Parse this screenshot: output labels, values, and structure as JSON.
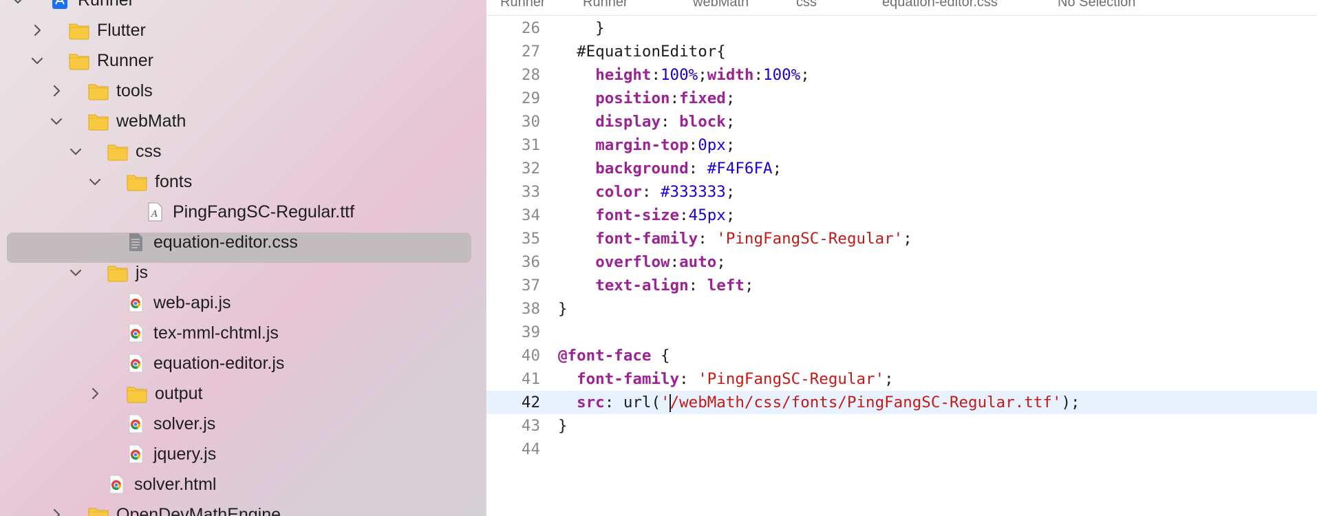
{
  "navigator": {
    "items": [
      {
        "label": "Runner",
        "icon": "xcode-project-icon",
        "chevron": "down"
      },
      {
        "label": "Flutter",
        "icon": "folder-icon",
        "chevron": "right"
      },
      {
        "label": "Runner",
        "icon": "folder-icon",
        "chevron": "down"
      },
      {
        "label": "tools",
        "icon": "folder-icon",
        "chevron": "right"
      },
      {
        "label": "webMath",
        "icon": "folder-icon",
        "chevron": "down"
      },
      {
        "label": "css",
        "icon": "folder-icon",
        "chevron": "down"
      },
      {
        "label": "fonts",
        "icon": "folder-icon",
        "chevron": "down"
      },
      {
        "label": "PingFangSC-Regular.ttf",
        "icon": "font-file-icon",
        "chevron": ""
      },
      {
        "label": "equation-editor.css",
        "icon": "css-file-icon",
        "chevron": "",
        "selected": true
      },
      {
        "label": "js",
        "icon": "folder-icon",
        "chevron": "down"
      },
      {
        "label": "web-api.js",
        "icon": "chrome-file-icon",
        "chevron": ""
      },
      {
        "label": "tex-mml-chtml.js",
        "icon": "chrome-file-icon",
        "chevron": ""
      },
      {
        "label": "equation-editor.js",
        "icon": "chrome-file-icon",
        "chevron": ""
      },
      {
        "label": "output",
        "icon": "folder-icon",
        "chevron": "right"
      },
      {
        "label": "solver.js",
        "icon": "chrome-file-icon",
        "chevron": ""
      },
      {
        "label": "jquery.js",
        "icon": "chrome-file-icon",
        "chevron": ""
      },
      {
        "label": "solver.html",
        "icon": "chrome-file-icon",
        "chevron": ""
      },
      {
        "label": "OpenDevMathEngine",
        "icon": "folder-icon",
        "chevron": "right"
      }
    ],
    "colors": {
      "folder": "#f9c941",
      "selection": "#c2bcbf",
      "project_icon": "#1e6ff0"
    }
  },
  "jumpbar": {
    "crumbs": [
      "Runner",
      "Runner",
      "webMath",
      "css",
      "equation-editor.css",
      "No Selection"
    ]
  },
  "editor": {
    "current_line": 42,
    "lines": [
      {
        "num": "26",
        "tokens": [
          {
            "t": "plain",
            "v": "    }"
          }
        ]
      },
      {
        "num": "27",
        "tokens": [
          {
            "t": "plain",
            "v": "  #EquationEditor{"
          }
        ]
      },
      {
        "num": "28",
        "tokens": [
          {
            "t": "plain",
            "v": "    "
          },
          {
            "t": "prop",
            "v": "height"
          },
          {
            "t": "plain",
            "v": ":"
          },
          {
            "t": "val",
            "v": "100%"
          },
          {
            "t": "plain",
            "v": ";"
          },
          {
            "t": "prop",
            "v": "width"
          },
          {
            "t": "plain",
            "v": ":"
          },
          {
            "t": "val",
            "v": "100%"
          },
          {
            "t": "plain",
            "v": ";"
          }
        ]
      },
      {
        "num": "29",
        "tokens": [
          {
            "t": "plain",
            "v": "    "
          },
          {
            "t": "prop",
            "v": "position"
          },
          {
            "t": "plain",
            "v": ":"
          },
          {
            "t": "kw",
            "v": "fixed"
          },
          {
            "t": "plain",
            "v": ";"
          }
        ]
      },
      {
        "num": "30",
        "tokens": [
          {
            "t": "plain",
            "v": "    "
          },
          {
            "t": "prop",
            "v": "display"
          },
          {
            "t": "plain",
            "v": ": "
          },
          {
            "t": "kw",
            "v": "block"
          },
          {
            "t": "plain",
            "v": ";"
          }
        ]
      },
      {
        "num": "31",
        "tokens": [
          {
            "t": "plain",
            "v": "    "
          },
          {
            "t": "prop",
            "v": "margin-top"
          },
          {
            "t": "plain",
            "v": ":"
          },
          {
            "t": "val",
            "v": "0px"
          },
          {
            "t": "plain",
            "v": ";"
          }
        ]
      },
      {
        "num": "32",
        "tokens": [
          {
            "t": "plain",
            "v": "    "
          },
          {
            "t": "prop",
            "v": "background"
          },
          {
            "t": "plain",
            "v": ": "
          },
          {
            "t": "val",
            "v": "#F4F6FA"
          },
          {
            "t": "plain",
            "v": ";"
          }
        ]
      },
      {
        "num": "33",
        "tokens": [
          {
            "t": "plain",
            "v": "    "
          },
          {
            "t": "prop",
            "v": "color"
          },
          {
            "t": "plain",
            "v": ": "
          },
          {
            "t": "val",
            "v": "#333333"
          },
          {
            "t": "plain",
            "v": ";"
          }
        ]
      },
      {
        "num": "34",
        "tokens": [
          {
            "t": "plain",
            "v": "    "
          },
          {
            "t": "prop",
            "v": "font-size"
          },
          {
            "t": "plain",
            "v": ":"
          },
          {
            "t": "val",
            "v": "45px"
          },
          {
            "t": "plain",
            "v": ";"
          }
        ]
      },
      {
        "num": "35",
        "tokens": [
          {
            "t": "plain",
            "v": "    "
          },
          {
            "t": "prop",
            "v": "font-family"
          },
          {
            "t": "plain",
            "v": ": "
          },
          {
            "t": "str",
            "v": "'PingFangSC-Regular'"
          },
          {
            "t": "plain",
            "v": ";"
          }
        ]
      },
      {
        "num": "36",
        "tokens": [
          {
            "t": "plain",
            "v": "    "
          },
          {
            "t": "prop",
            "v": "overflow"
          },
          {
            "t": "plain",
            "v": ":"
          },
          {
            "t": "kw",
            "v": "auto"
          },
          {
            "t": "plain",
            "v": ";"
          }
        ]
      },
      {
        "num": "37",
        "tokens": [
          {
            "t": "plain",
            "v": "    "
          },
          {
            "t": "prop",
            "v": "text-align"
          },
          {
            "t": "plain",
            "v": ": "
          },
          {
            "t": "kw",
            "v": "left"
          },
          {
            "t": "plain",
            "v": ";"
          }
        ]
      },
      {
        "num": "38",
        "tokens": [
          {
            "t": "plain",
            "v": "}"
          }
        ]
      },
      {
        "num": "39",
        "tokens": []
      },
      {
        "num": "40",
        "tokens": [
          {
            "t": "kw",
            "v": "@font-face"
          },
          {
            "t": "plain",
            "v": " {"
          }
        ]
      },
      {
        "num": "41",
        "tokens": [
          {
            "t": "plain",
            "v": "  "
          },
          {
            "t": "prop",
            "v": "font-family"
          },
          {
            "t": "plain",
            "v": ": "
          },
          {
            "t": "str",
            "v": "'PingFangSC-Regular'"
          },
          {
            "t": "plain",
            "v": ";"
          }
        ]
      },
      {
        "num": "42",
        "tokens": [
          {
            "t": "plain",
            "v": "  "
          },
          {
            "t": "prop",
            "v": "src"
          },
          {
            "t": "plain",
            "v": ": "
          },
          {
            "t": "plain",
            "v": "url("
          },
          {
            "t": "str",
            "v": "'"
          },
          {
            "t": "caret",
            "v": ""
          },
          {
            "t": "str",
            "v": "/webMath/css/fonts/PingFangSC-Regular.ttf'"
          },
          {
            "t": "plain",
            "v": ");"
          }
        ]
      },
      {
        "num": "43",
        "tokens": [
          {
            "t": "plain",
            "v": "}"
          }
        ]
      },
      {
        "num": "44",
        "tokens": []
      }
    ]
  }
}
